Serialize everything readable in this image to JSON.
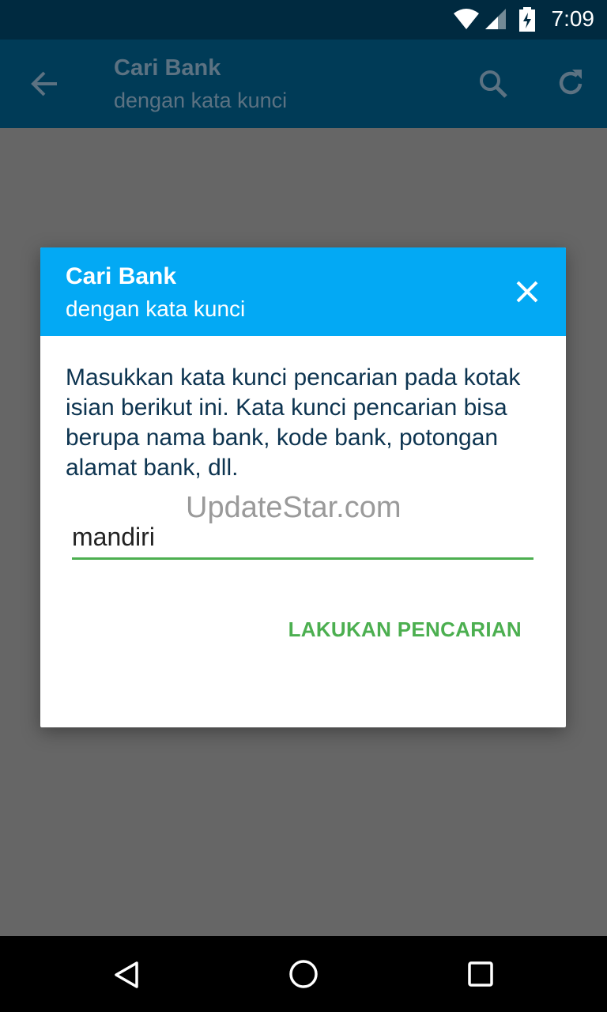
{
  "status_bar": {
    "time": "7:09",
    "icons": [
      "wifi-icon",
      "signal-icon",
      "battery-charging-icon"
    ]
  },
  "app_bar": {
    "title": "Cari Bank",
    "subtitle": "dengan kata kunci",
    "icons": [
      "back-arrow-icon",
      "search-icon",
      "refresh-icon"
    ]
  },
  "dialog": {
    "title": "Cari Bank",
    "subtitle": "dengan kata kunci",
    "description": "Masukkan kata kunci pencarian pada kotak isian berikut ini. Kata kunci pencarian bisa berupa nama bank, kode bank, potongan alamat bank, dll.",
    "input_value": "mandiri",
    "action_label": "LAKUKAN PENCARIAN",
    "watermark": "UpdateStar.com"
  },
  "colors": {
    "status_bar": "#002a40",
    "app_bar": "#003b57",
    "dialog_header": "#03a9f4",
    "accent_green": "#4caf50",
    "scrim": "#666666"
  },
  "nav_bar": {
    "icons": [
      "back-triangle-icon",
      "home-circle-icon",
      "recents-square-icon"
    ]
  }
}
